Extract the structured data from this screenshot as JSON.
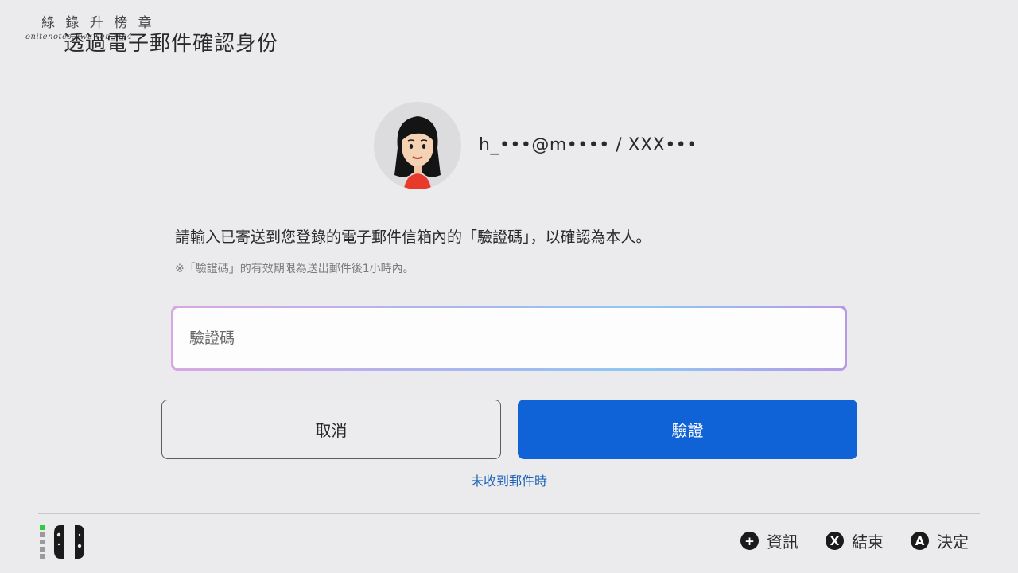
{
  "watermark": {
    "line1": "綠 錄 升 榜 章",
    "line2": "onitenotes.uwuweb.mp4"
  },
  "header": {
    "title": "透過電子郵件確認身份"
  },
  "account": {
    "label": "h_•••@m•••• / XXX•••"
  },
  "main": {
    "instruction": "請輸入已寄送到您登錄的電子郵件信箱內的「驗證碼」，以確認為本人。",
    "note": "※「驗證碼」的有效期限為送出郵件後1小時內。",
    "code_input": {
      "placeholder": "驗證碼",
      "value": ""
    },
    "cancel_label": "取消",
    "verify_label": "驗證",
    "help_link": "未收到郵件時"
  },
  "footer": {
    "hints": [
      {
        "button": "+",
        "label": "資訊",
        "icon": "plus-button-icon"
      },
      {
        "button": "X",
        "label": "結束",
        "icon": "x-button-icon"
      },
      {
        "button": "A",
        "label": "決定",
        "icon": "a-button-icon"
      }
    ]
  },
  "colors": {
    "background": "#ebebed",
    "accent": "#0f63d6",
    "link": "#1e63b8",
    "status_green": "#2ecc40"
  }
}
